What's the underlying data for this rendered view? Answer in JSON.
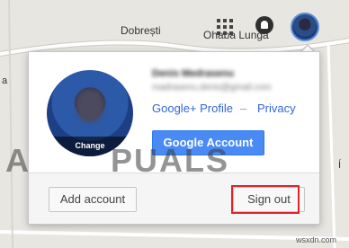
{
  "map": {
    "labels": {
      "dobresti": "Dobrești",
      "ohaba": "Ohaba Lunga",
      "edge_left": "a",
      "edge_right": "Í"
    },
    "colors": {
      "background": "#e8e6e1",
      "road": "#ffffff",
      "road_outline": "#cfcac2"
    }
  },
  "topbar": {
    "apps_icon": "apps-grid-icon",
    "notifications_icon": "bell-icon",
    "avatar": "profile-avatar"
  },
  "account_popup": {
    "avatar_change_label": "Change",
    "user_name": "Denis Medrasenu",
    "user_email": "madrasenu.denis@gmail.com",
    "links": {
      "profile": "Google+ Profile",
      "separator": "–",
      "privacy": "Privacy"
    },
    "google_account_button": "Google Account",
    "add_account_button": "Add account",
    "sign_out_button": "Sign out",
    "colors": {
      "primary_button": "#4a8af4",
      "link": "#3367d6",
      "highlight": "#d8262e"
    }
  },
  "watermark": {
    "left": "A",
    "right": "PUALS"
  },
  "site_tag": "wsxdn.com"
}
